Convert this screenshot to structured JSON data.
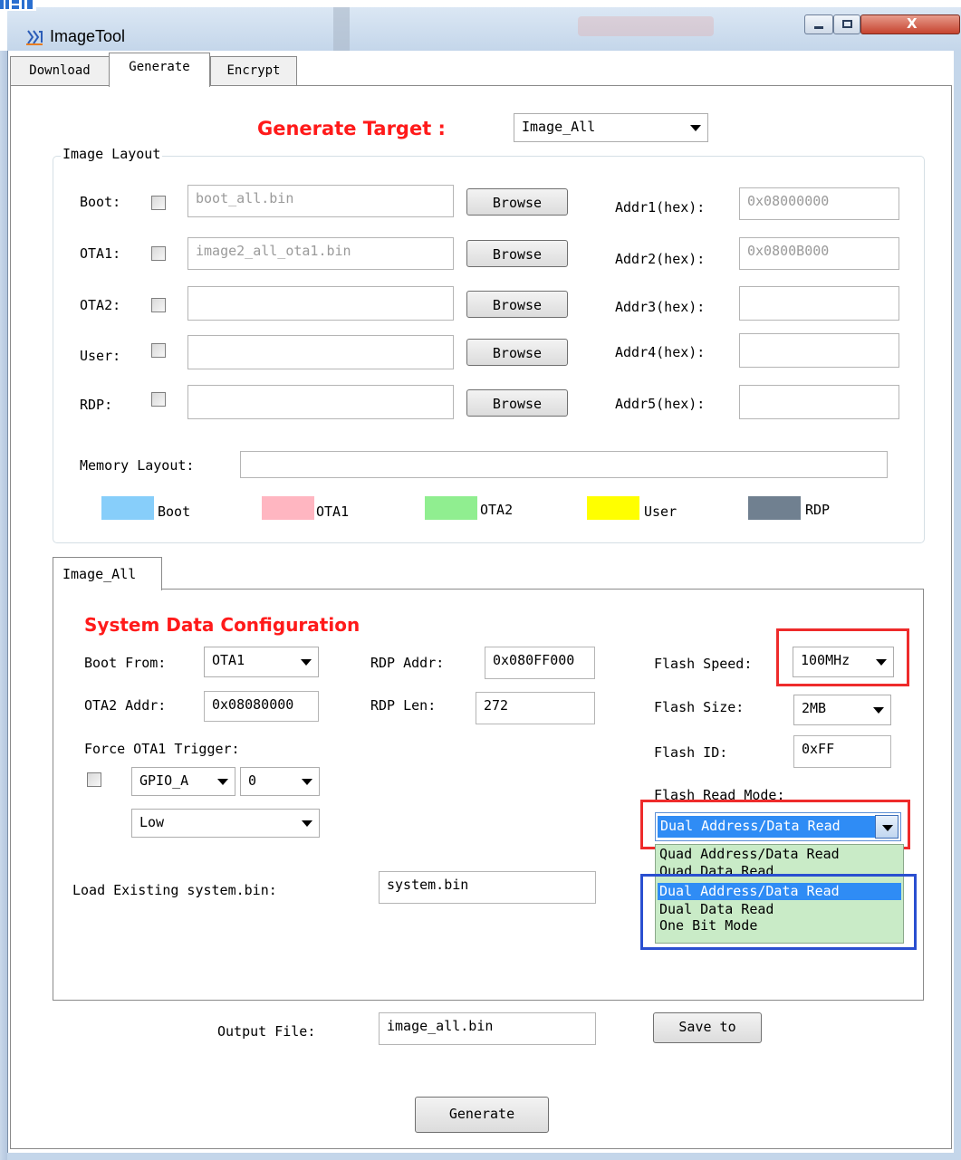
{
  "window": {
    "title": "ImageTool",
    "close_glyph": "X"
  },
  "tabs": [
    "Download",
    "Generate",
    "Encrypt"
  ],
  "generate_target": {
    "label": "Generate Target :",
    "value": "Image_All"
  },
  "image_layout": {
    "title": "Image Layout",
    "browse_label": "Browse",
    "rows": [
      {
        "label": "Boot:",
        "file": "boot_all.bin",
        "addr_label": "Addr1(hex):",
        "addr": "0x08000000"
      },
      {
        "label": "OTA1:",
        "file": "image2_all_ota1.bin",
        "addr_label": "Addr2(hex):",
        "addr": "0x0800B000"
      },
      {
        "label": "OTA2:",
        "file": "",
        "addr_label": "Addr3(hex):",
        "addr": ""
      },
      {
        "label": "User:",
        "file": "",
        "addr_label": "Addr4(hex):",
        "addr": ""
      },
      {
        "label": "RDP:",
        "file": "",
        "addr_label": "Addr5(hex):",
        "addr": ""
      }
    ],
    "memory_layout_label": "Memory Layout:",
    "legend": [
      {
        "name": "Boot",
        "color": "#87cefa"
      },
      {
        "name": "OTA1",
        "color": "#ffb6c1"
      },
      {
        "name": "OTA2",
        "color": "#90ee90"
      },
      {
        "name": "User",
        "color": "#ffff00"
      },
      {
        "name": "RDP",
        "color": "#708090"
      }
    ]
  },
  "inner_tab": "Image_All",
  "system": {
    "heading": "System Data Configuration",
    "boot_from_label": "Boot From:",
    "boot_from": "OTA1",
    "ota2_addr_label": "OTA2 Addr:",
    "ota2_addr": "0x08080000",
    "force_trigger_label": "Force OTA1 Trigger:",
    "gpio_port": "GPIO_A",
    "gpio_pin": "0",
    "gpio_level": "Low",
    "rdp_addr_label": "RDP Addr:",
    "rdp_addr": "0x080FF000",
    "rdp_len_label": "RDP Len:",
    "rdp_len": "272",
    "flash_speed_label": "Flash Speed:",
    "flash_speed": "100MHz",
    "flash_size_label": "Flash Size:",
    "flash_size": "2MB",
    "flash_id_label": "Flash ID:",
    "flash_id": "0xFF",
    "flash_read_mode_label": "Flash Read Mode:",
    "flash_read_mode": "Dual Address/Data Read",
    "flash_read_mode_options": [
      "Quad Address/Data Read",
      "Quad Data Read",
      "Dual Address/Data Read",
      "Dual Data Read",
      "One Bit Mode"
    ],
    "load_label": "Load Existing system.bin:",
    "load_value": "system.bin"
  },
  "output": {
    "label": "Output File:",
    "value": "image_all.bin",
    "save_label": "Save to"
  },
  "generate_button": "Generate",
  "colors": {
    "heading_red": "#ff1a1a",
    "highlight_red": "#ee2b2b",
    "highlight_blue": "#2a4fd0",
    "selection": "#2f8cf5",
    "list_bg": "#c9ebc7"
  }
}
